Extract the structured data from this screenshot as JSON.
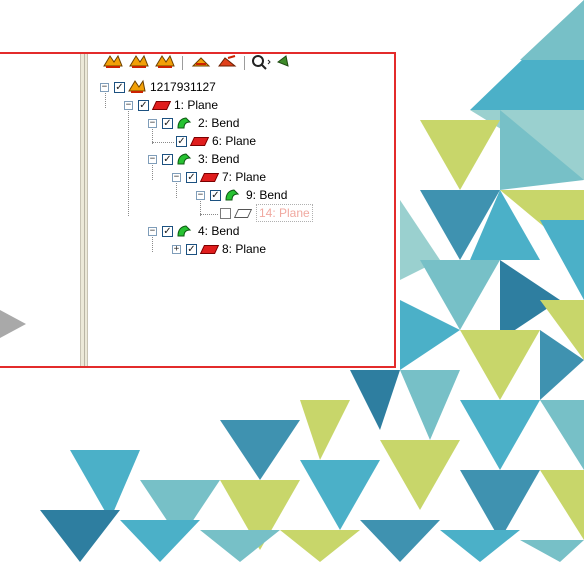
{
  "background": {
    "colors": [
      "#4bb0c8",
      "#3f92b0",
      "#77c0c7",
      "#c8d66a",
      "#2e7ea0",
      "#9ad0cf"
    ]
  },
  "panel": {
    "border_color": "#e32b2b",
    "toolbar": {
      "icons": [
        "sheet-metal-icon-1",
        "sheet-metal-icon-2",
        "sheet-metal-icon-3",
        "flatten-icon",
        "unfold-icon",
        "zoom-icon",
        "options-icon"
      ]
    },
    "tree": {
      "root": "1217931127",
      "nodes": [
        {
          "label": "1: Plane"
        },
        {
          "label": "2: Bend"
        },
        {
          "label": "6: Plane"
        },
        {
          "label": "3: Bend"
        },
        {
          "label": "7: Plane"
        },
        {
          "label": "9: Bend"
        },
        {
          "label": "14: Plane"
        },
        {
          "label": "4: Bend"
        },
        {
          "label": "8: Plane"
        }
      ]
    }
  }
}
